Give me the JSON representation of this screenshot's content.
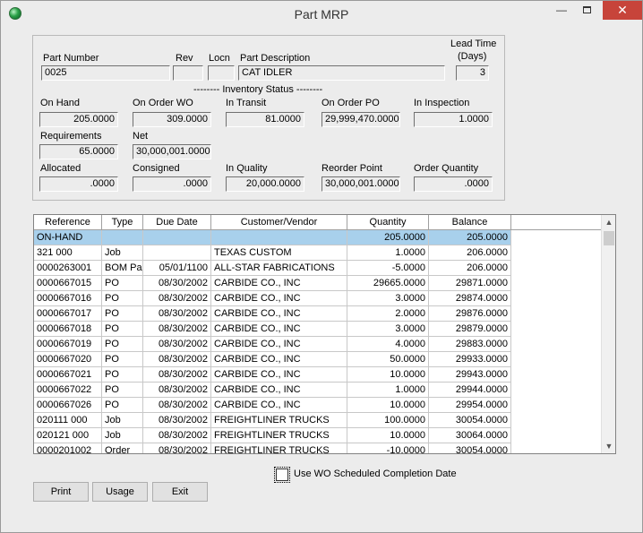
{
  "window": {
    "title": "Part MRP"
  },
  "header": {
    "part_number_label": "Part Number",
    "part_number": "0025",
    "rev_label": "Rev",
    "rev": "",
    "locn_label": "Locn",
    "locn": "",
    "desc_label": "Part Description",
    "desc": "CAT IDLER",
    "lead_time_label_1": "Lead Time",
    "lead_time_label_2": "(Days)",
    "lead_time": "3"
  },
  "inventory": {
    "section_title": "-------- Inventory Status --------",
    "on_hand_label": "On Hand",
    "on_hand": "205.0000",
    "on_order_wo_label": "On Order WO",
    "on_order_wo": "309.0000",
    "in_transit_label": "In Transit",
    "in_transit": "81.0000",
    "on_order_po_label": "On Order PO",
    "on_order_po": "29,999,470.0000",
    "in_inspection_label": "In Inspection",
    "in_inspection": "1.0000",
    "requirements_label": "Requirements",
    "requirements": "65.0000",
    "net_label": "Net",
    "net": "30,000,001.0000",
    "allocated_label": "Allocated",
    "allocated": ".0000",
    "consigned_label": "Consigned",
    "consigned": ".0000",
    "in_quality_label": "In Quality",
    "in_quality": "20,000.0000",
    "reorder_point_label": "Reorder Point",
    "reorder_point": "30,000,001.0000",
    "order_quantity_label": "Order Quantity",
    "order_quantity": ".0000"
  },
  "grid": {
    "columns": [
      "Reference",
      "Type",
      "Due Date",
      "Customer/Vendor",
      "Quantity",
      "Balance"
    ],
    "rows": [
      [
        "ON-HAND",
        "",
        "",
        "",
        "205.0000",
        "205.0000"
      ],
      [
        "321     000",
        "Job",
        "",
        "TEXAS CUSTOM",
        "1.0000",
        "206.0000"
      ],
      [
        "0000263001",
        "BOM Par",
        "05/01/1100",
        "ALL-STAR FABRICATIONS",
        "-5.0000",
        "206.0000"
      ],
      [
        "0000667015",
        "PO",
        "08/30/2002",
        "CARBIDE CO., INC",
        "29665.0000",
        "29871.0000"
      ],
      [
        "0000667016",
        "PO",
        "08/30/2002",
        "CARBIDE CO., INC",
        "3.0000",
        "29874.0000"
      ],
      [
        "0000667017",
        "PO",
        "08/30/2002",
        "CARBIDE CO., INC",
        "2.0000",
        "29876.0000"
      ],
      [
        "0000667018",
        "PO",
        "08/30/2002",
        "CARBIDE CO., INC",
        "3.0000",
        "29879.0000"
      ],
      [
        "0000667019",
        "PO",
        "08/30/2002",
        "CARBIDE CO., INC",
        "4.0000",
        "29883.0000"
      ],
      [
        "0000667020",
        "PO",
        "08/30/2002",
        "CARBIDE CO., INC",
        "50.0000",
        "29933.0000"
      ],
      [
        "0000667021",
        "PO",
        "08/30/2002",
        "CARBIDE CO., INC",
        "10.0000",
        "29943.0000"
      ],
      [
        "0000667022",
        "PO",
        "08/30/2002",
        "CARBIDE CO., INC",
        "1.0000",
        "29944.0000"
      ],
      [
        "0000667026",
        "PO",
        "08/30/2002",
        "CARBIDE CO., INC",
        "10.0000",
        "29954.0000"
      ],
      [
        "020111 000",
        "Job",
        "08/30/2002",
        "FREIGHTLINER TRUCKS",
        "100.0000",
        "30054.0000"
      ],
      [
        "020121 000",
        "Job",
        "08/30/2002",
        "FREIGHTLINER TRUCKS",
        "10.0000",
        "30064.0000"
      ],
      [
        "0000201002",
        "Order",
        "08/30/2002",
        "FREIGHTLINER TRUCKS",
        "-10.0000",
        "30054.0000"
      ]
    ],
    "selected_row": 0,
    "selected_color": "#a8d0ec"
  },
  "options": {
    "use_wo_scheduled_label": "Use WO Scheduled Completion Date",
    "use_wo_scheduled": false
  },
  "buttons": {
    "print": "Print",
    "usage": "Usage",
    "exit": "Exit"
  }
}
